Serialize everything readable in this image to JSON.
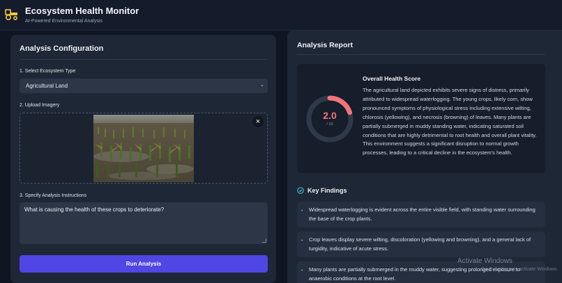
{
  "header": {
    "title": "Ecosystem Health Monitor",
    "subtitle": "AI-Powered Environmental Analysis",
    "logo_icon": "tractor-icon"
  },
  "config": {
    "title": "Analysis Configuration",
    "ecosystem_label": "1. Select Ecosystem Type",
    "ecosystem_value": "Agricultural Land",
    "upload_label": "2. Upload Imagery",
    "instructions_label": "3. Specify Analysis Instructions",
    "instructions_value": "What is causing the health of these crops to deteriorate?",
    "run_label": "Run Analysis",
    "accent_color": "#4f46e5"
  },
  "report": {
    "title": "Analysis Report",
    "score": {
      "heading": "Overall Health Score",
      "value": "2.0",
      "max": "/ 10",
      "fraction": 0.2,
      "color": "#f4747a",
      "description": "The agricultural land depicted exhibits severe signs of distress, primarily attributed to widespread waterlogging. The young crops, likely corn, show pronounced symptoms of physiological stress including extensive wilting, chlorosis (yellowing), and necrosis (browning) of leaves. Many plants are partially submerged in muddy standing water, indicating saturated soil conditions that are highly detrimental to root health and overall plant vitality. This environment suggests a significant disruption to normal growth processes, leading to a critical decline in the ecosystem's health."
    },
    "findings_title": "Key Findings",
    "findings": [
      {
        "text": "Widespread waterlogging is evident across the entire visible field, with standing water surrounding the base of the crop plants."
      },
      {
        "text": "Crop leaves display severe wilting, discoloration (yellowing and browning), and a general lack of turgidity, indicative of acute stress."
      },
      {
        "text": "Many plants are partially submerged in the muddy water, suggesting prolonged exposure to anaerobic conditions at the root level."
      }
    ]
  },
  "overlay": {
    "watermark": "Activate Windows",
    "watermark_sub": "Go to Settings to activate Windows."
  }
}
